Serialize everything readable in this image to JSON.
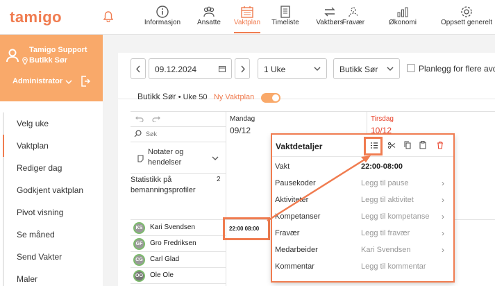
{
  "app": {
    "logo": "tamigo"
  },
  "nav": [
    {
      "label": "Informasjon",
      "icon": "info-icon"
    },
    {
      "label": "Ansatte",
      "icon": "people-icon"
    },
    {
      "label": "Vaktplan",
      "icon": "calendar-icon",
      "active": true
    },
    {
      "label": "Timeliste",
      "icon": "timesheet-icon"
    },
    {
      "label": "Vaktbørs",
      "icon": "swap-icon"
    },
    {
      "label": "Fravær",
      "icon": "absence-icon"
    },
    {
      "label": "Økonomi",
      "icon": "economy-icon"
    },
    {
      "label": "Oppsett generelt",
      "icon": "gear-icon"
    }
  ],
  "user": {
    "name": "Tamigo Support",
    "store": "Butikk Sør",
    "role": "Administrator"
  },
  "menu": [
    {
      "label": "Velg uke"
    },
    {
      "label": "Vaktplan",
      "active": true
    },
    {
      "label": "Rediger dag"
    },
    {
      "label": "Godkjent vaktplan"
    },
    {
      "label": "Pivot visning"
    },
    {
      "label": "Se måned"
    },
    {
      "label": "Send Vakter"
    },
    {
      "label": "Maler"
    }
  ],
  "toolbar": {
    "date": "09.12.2024",
    "period": "1 Uke",
    "store": "Butikk Sør",
    "multi_label": "Planlegg for flere avde"
  },
  "subheader": {
    "store": "Butikk Sør",
    "week": "• Uke 50",
    "new_plan": "Ny Vaktplan"
  },
  "grid": {
    "search_placeholder": "Søk",
    "notes": "Notater og hendelser",
    "stats_label": "Statistikk på bemanningsprofiler",
    "stats_count": "2",
    "days": [
      {
        "name": "Mandag",
        "date": "09/12"
      },
      {
        "name": "Tirsdag",
        "date": "10/12"
      }
    ],
    "shift_text": "22:00 08:00"
  },
  "employees": [
    {
      "initials": "KS",
      "name": "Kari Svendsen",
      "color": "#9a9a9a"
    },
    {
      "initials": "GF",
      "name": "Gro Fredriksen",
      "color": "#9a9a9a"
    },
    {
      "initials": "CG",
      "name": "Carl Glad",
      "color": "#9a9a9a"
    },
    {
      "initials": "OO",
      "name": "Ole Ole",
      "color": "#777777"
    }
  ],
  "details": {
    "title": "Vaktdetaljer",
    "rows": [
      {
        "k": "Vakt",
        "v": "22:00-08:00",
        "dark": true,
        "chev": false
      },
      {
        "k": "Pausekoder",
        "v": "Legg til pause",
        "chev": true
      },
      {
        "k": "Aktiviteter",
        "v": "Legg til aktivitet",
        "chev": true
      },
      {
        "k": "Kompetanser",
        "v": "Legg til kompetanse",
        "chev": true
      },
      {
        "k": "Fravær",
        "v": "Legg til fravær",
        "chev": true
      },
      {
        "k": "Medarbeider",
        "v": "Kari Svendsen",
        "chev": true
      },
      {
        "k": "Kommentar",
        "v": "Legg til kommentar",
        "chev": false
      }
    ]
  },
  "colors": {
    "accent": "#f07c50",
    "sidebar": "#f9a96a",
    "tuesday": "#e8412a"
  }
}
